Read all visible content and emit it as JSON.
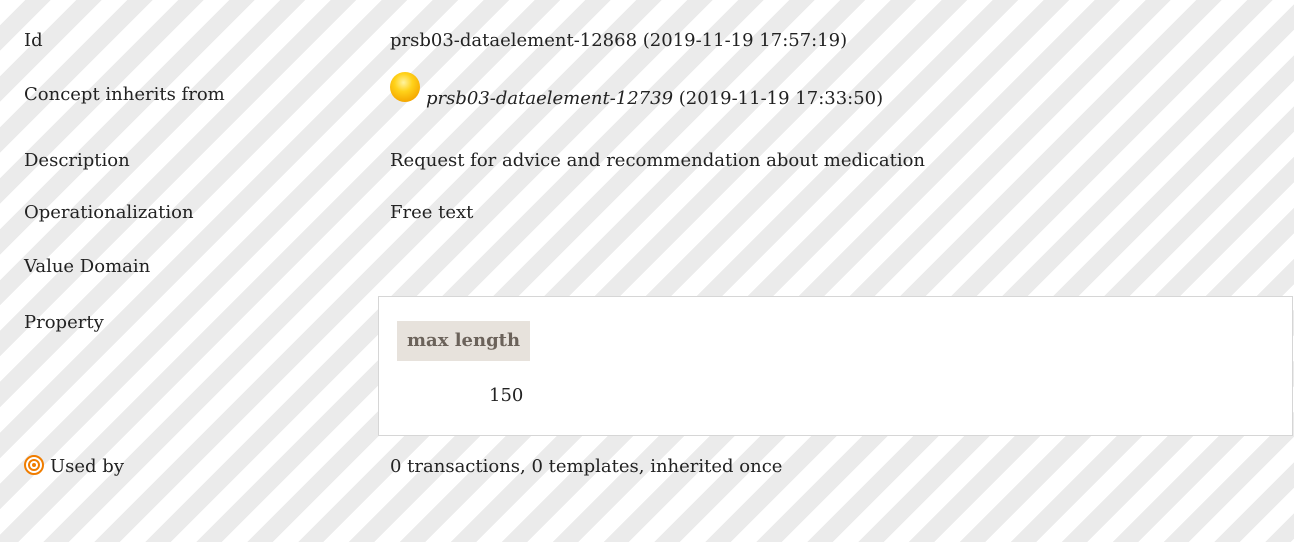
{
  "rows": {
    "id": {
      "label": "Id",
      "value": "prsb03-dataelement-12868 (2019-11-19 17:57:19)"
    },
    "inherits": {
      "label": "Concept inherits from",
      "value_link": "prsb03-dataelement-12739",
      "value_date": " (2019-11-19 17:33:50)",
      "status_icon": "yellow-circle-icon",
      "status_color": "#ffc400"
    },
    "description": {
      "label": "Description",
      "value": "Request for advice and recommendation about medication"
    },
    "operationalization": {
      "label": "Operationalization",
      "value": "Free text"
    },
    "value_domain": {
      "label": "Value Domain"
    },
    "property": {
      "label": "Property",
      "header": "max length",
      "value": "150"
    },
    "used_by": {
      "label": "Used by",
      "icon": "target-icon",
      "icon_color": "#f07d00",
      "value": "0 transactions, 0 templates, inherited once"
    }
  }
}
